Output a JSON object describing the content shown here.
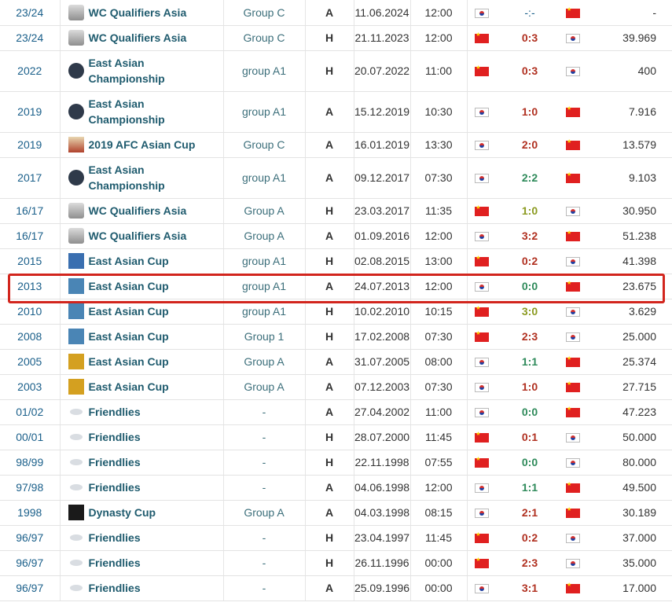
{
  "rows": [
    {
      "season": "23/24",
      "icon": "wc-qualifiers-icon",
      "competition": "WC Qualifiers Asia",
      "group": "Group C",
      "ha": "A",
      "date": "11.06.2024",
      "time": "12:00",
      "home_flag": "kr",
      "score": "-:-",
      "score_color": "dash",
      "away_flag": "cn",
      "attendance": "-"
    },
    {
      "season": "23/24",
      "icon": "wc-qualifiers-icon",
      "competition": "WC Qualifiers Asia",
      "group": "Group C",
      "ha": "H",
      "date": "21.11.2023",
      "time": "12:00",
      "home_flag": "cn",
      "score": "0:3",
      "score_color": "red",
      "away_flag": "kr",
      "attendance": "39.969"
    },
    {
      "season": "2022",
      "icon": "east-asian-championship-icon",
      "competition": "East Asian Championship",
      "group": "group A1",
      "ha": "H",
      "date": "20.07.2022",
      "time": "11:00",
      "home_flag": "cn",
      "score": "0:3",
      "score_color": "red",
      "away_flag": "kr",
      "attendance": "400"
    },
    {
      "season": "2019",
      "icon": "east-asian-championship-icon",
      "competition": "East Asian Championship",
      "group": "group A1",
      "ha": "A",
      "date": "15.12.2019",
      "time": "10:30",
      "home_flag": "kr",
      "score": "1:0",
      "score_color": "red",
      "away_flag": "cn",
      "attendance": "7.916"
    },
    {
      "season": "2019",
      "icon": "afc-asian-cup-icon",
      "competition": "2019 AFC Asian Cup",
      "group": "Group C",
      "ha": "A",
      "date": "16.01.2019",
      "time": "13:30",
      "home_flag": "kr",
      "score": "2:0",
      "score_color": "red",
      "away_flag": "cn",
      "attendance": "13.579"
    },
    {
      "season": "2017",
      "icon": "east-asian-championship-icon",
      "competition": "East Asian Championship",
      "group": "group A1",
      "ha": "A",
      "date": "09.12.2017",
      "time": "07:30",
      "home_flag": "kr",
      "score": "2:2",
      "score_color": "green",
      "away_flag": "cn",
      "attendance": "9.103"
    },
    {
      "season": "16/17",
      "icon": "wc-qualifiers-icon",
      "competition": "WC Qualifiers Asia",
      "group": "Group A",
      "ha": "H",
      "date": "23.03.2017",
      "time": "11:35",
      "home_flag": "cn",
      "score": "1:0",
      "score_color": "olive",
      "away_flag": "kr",
      "attendance": "30.950"
    },
    {
      "season": "16/17",
      "icon": "wc-qualifiers-icon",
      "competition": "WC Qualifiers Asia",
      "group": "Group A",
      "ha": "A",
      "date": "01.09.2016",
      "time": "12:00",
      "home_flag": "kr",
      "score": "3:2",
      "score_color": "red",
      "away_flag": "cn",
      "attendance": "51.238"
    },
    {
      "season": "2015",
      "icon": "east-asian-cup-2015-icon",
      "competition": "East Asian Cup",
      "group": "group A1",
      "ha": "H",
      "date": "02.08.2015",
      "time": "13:00",
      "home_flag": "cn",
      "score": "0:2",
      "score_color": "red",
      "away_flag": "kr",
      "attendance": "41.398"
    },
    {
      "season": "2013",
      "icon": "east-asian-cup-2013-icon",
      "competition": "East Asian Cup",
      "group": "group A1",
      "ha": "A",
      "date": "24.07.2013",
      "time": "12:00",
      "home_flag": "kr",
      "score": "0:0",
      "score_color": "green",
      "away_flag": "cn",
      "attendance": "23.675"
    },
    {
      "season": "2010",
      "icon": "east-asian-cup-2010-icon",
      "competition": "East Asian Cup",
      "group": "group A1",
      "ha": "H",
      "date": "10.02.2010",
      "time": "10:15",
      "home_flag": "cn",
      "score": "3:0",
      "score_color": "olive",
      "away_flag": "kr",
      "attendance": "3.629"
    },
    {
      "season": "2008",
      "icon": "east-asian-cup-2008-icon",
      "competition": "East Asian Cup",
      "group": "Group 1",
      "ha": "H",
      "date": "17.02.2008",
      "time": "07:30",
      "home_flag": "cn",
      "score": "2:3",
      "score_color": "red",
      "away_flag": "kr",
      "attendance": "25.000"
    },
    {
      "season": "2005",
      "icon": "east-asian-cup-2005-icon",
      "competition": "East Asian Cup",
      "group": "Group A",
      "ha": "A",
      "date": "31.07.2005",
      "time": "08:00",
      "home_flag": "kr",
      "score": "1:1",
      "score_color": "green",
      "away_flag": "cn",
      "attendance": "25.374"
    },
    {
      "season": "2003",
      "icon": "east-asian-cup-2003-icon",
      "competition": "East Asian Cup",
      "group": "Group A",
      "ha": "A",
      "date": "07.12.2003",
      "time": "07:30",
      "home_flag": "kr",
      "score": "1:0",
      "score_color": "red",
      "away_flag": "cn",
      "attendance": "27.715"
    },
    {
      "season": "01/02",
      "icon": "friendlies-icon",
      "competition": "Friendlies",
      "group": "-",
      "ha": "A",
      "date": "27.04.2002",
      "time": "11:00",
      "home_flag": "kr",
      "score": "0:0",
      "score_color": "green",
      "away_flag": "cn",
      "attendance": "47.223"
    },
    {
      "season": "00/01",
      "icon": "friendlies-icon",
      "competition": "Friendlies",
      "group": "-",
      "ha": "H",
      "date": "28.07.2000",
      "time": "11:45",
      "home_flag": "cn",
      "score": "0:1",
      "score_color": "red",
      "away_flag": "kr",
      "attendance": "50.000"
    },
    {
      "season": "98/99",
      "icon": "friendlies-icon",
      "competition": "Friendlies",
      "group": "-",
      "ha": "H",
      "date": "22.11.1998",
      "time": "07:55",
      "home_flag": "cn",
      "score": "0:0",
      "score_color": "green",
      "away_flag": "kr",
      "attendance": "80.000"
    },
    {
      "season": "97/98",
      "icon": "friendlies-icon",
      "competition": "Friendlies",
      "group": "-",
      "ha": "A",
      "date": "04.06.1998",
      "time": "12:00",
      "home_flag": "kr",
      "score": "1:1",
      "score_color": "green",
      "away_flag": "cn",
      "attendance": "49.500"
    },
    {
      "season": "1998",
      "icon": "dynasty-cup-icon",
      "competition": "Dynasty Cup",
      "group": "Group A",
      "ha": "A",
      "date": "04.03.1998",
      "time": "08:15",
      "home_flag": "kr",
      "score": "2:1",
      "score_color": "red",
      "away_flag": "cn",
      "attendance": "30.189"
    },
    {
      "season": "96/97",
      "icon": "friendlies-icon",
      "competition": "Friendlies",
      "group": "-",
      "ha": "H",
      "date": "23.04.1997",
      "time": "11:45",
      "home_flag": "cn",
      "score": "0:2",
      "score_color": "red",
      "away_flag": "kr",
      "attendance": "37.000"
    },
    {
      "season": "96/97",
      "icon": "friendlies-icon",
      "competition": "Friendlies",
      "group": "-",
      "ha": "H",
      "date": "26.11.1996",
      "time": "00:00",
      "home_flag": "cn",
      "score": "2:3",
      "score_color": "red",
      "away_flag": "kr",
      "attendance": "35.000"
    },
    {
      "season": "96/97",
      "icon": "friendlies-icon",
      "competition": "Friendlies",
      "group": "-",
      "ha": "A",
      "date": "25.09.1996",
      "time": "00:00",
      "home_flag": "kr",
      "score": "3:1",
      "score_color": "red",
      "away_flag": "cn",
      "attendance": "17.000"
    }
  ],
  "highlighted_season": "2013",
  "colors": {
    "highlight_border": "#d2251d",
    "link": "#1a5f8a",
    "competition": "#1f5b6e",
    "score_red": "#b03020",
    "score_green": "#2e8a5a",
    "score_olive": "#8b9a20"
  }
}
